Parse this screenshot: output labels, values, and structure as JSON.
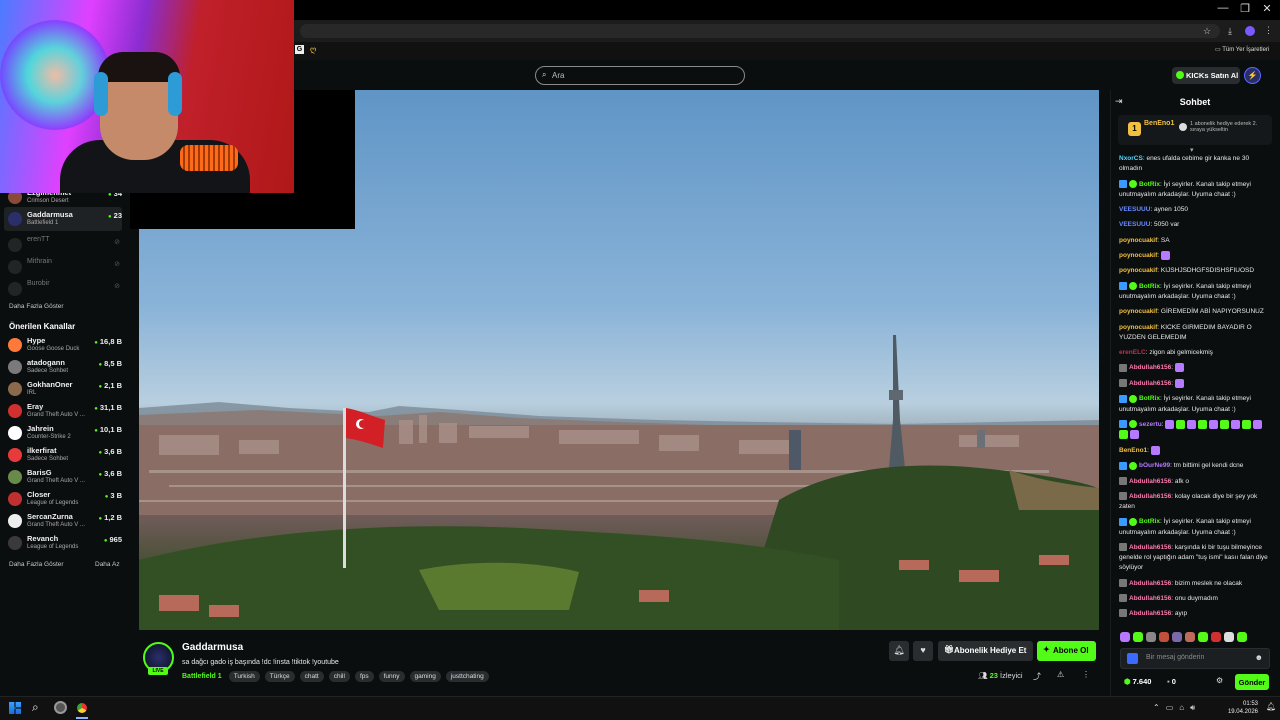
{
  "browser": {
    "bookmarks_label": "Tüm Yer İşaretleri",
    "window_controls": [
      "—",
      "❐",
      "✕"
    ]
  },
  "topnav": {
    "search_placeholder": "Ara",
    "kicks_label": "KICKs Satın Al"
  },
  "sidebar": {
    "followed": [
      {
        "name": "Ezgimehmet",
        "category": "Crimson Desert",
        "viewers": "34",
        "online": true
      },
      {
        "name": "Gaddarmusa",
        "category": "Battlefield 1",
        "viewers": "23",
        "online": true
      },
      {
        "name": "erenTT",
        "online": false
      },
      {
        "name": "Mithrain",
        "online": false
      },
      {
        "name": "Burobir",
        "online": false
      }
    ],
    "show_more": "Daha Fazla Göster",
    "recommended_title": "Önerilen Kanallar",
    "recommended": [
      {
        "name": "Hype",
        "category": "Goose Goose Duck",
        "viewers": "16,8 B",
        "color": "#ff7a3a"
      },
      {
        "name": "atadogann",
        "category": "Sadece Sohbet",
        "viewers": "8,5 B",
        "color": "#7a7a7a"
      },
      {
        "name": "GokhanOner",
        "category": "IRL",
        "viewers": "2,1 B",
        "color": "#8a6a4a"
      },
      {
        "name": "Eray",
        "category": "Grand Theft Auto V ...",
        "viewers": "31,1 B",
        "color": "#d03030"
      },
      {
        "name": "Jahrein",
        "category": "Counter-Strike 2",
        "viewers": "10,1 B",
        "color": "#ffffff"
      },
      {
        "name": "ilkerfirat",
        "category": "Sadece Sohbet",
        "viewers": "3,6 B",
        "color": "#e83a3a"
      },
      {
        "name": "BarisG",
        "category": "Grand Theft Auto V ...",
        "viewers": "3,6 B",
        "color": "#6a8a4a"
      },
      {
        "name": "Closer",
        "category": "League of Legends",
        "viewers": "3 B",
        "color": "#c03030"
      },
      {
        "name": "SercanZurna",
        "category": "Grand Theft Auto V ...",
        "viewers": "1,2 B",
        "color": "#eeeeee"
      },
      {
        "name": "Revanch",
        "category": "League of Legends",
        "viewers": "965",
        "color": "#3a3a3a"
      }
    ],
    "show_more2": "Daha Fazla Göster",
    "show_less": "Daha Az"
  },
  "stream": {
    "channel_name": "Gaddarmusa",
    "live_badge": "LIVE",
    "title": "sa dağcı gado iş başında  !dc !insta !tiktok !youtube",
    "game": "Battlefield 1",
    "tags": [
      "Turkish",
      "Türkçe",
      "chatt",
      "chill",
      "fps",
      "funny",
      "gaming",
      "justtchating"
    ],
    "gift_label": "Abonelik Hediye Et",
    "subscribe_label": "Abone Ol",
    "viewer_count": "23",
    "viewer_suffix": "İzleyici"
  },
  "chat": {
    "title": "Sohbet",
    "pinned": {
      "rank": "1",
      "user": "BenEno1",
      "text": "1 abonelik hediye ederek 2. sıraya yükseltin"
    },
    "messages": [
      {
        "user": "NxorCS",
        "color": "#53d6ff",
        "text": ": enes ufalda cebime gir kanka ne 30 olmadın"
      },
      {
        "user": "BotRix",
        "color": "#53fc18",
        "text": ": İyi seyirler. Kanalı takip etmeyi unutmayalım arkadaşlar. Uyuma chaat :)"
      },
      {
        "user": "VEESUUU",
        "color": "#6a8aff",
        "text": ": aynen 1050"
      },
      {
        "user": "VEESUUU",
        "color": "#6a8aff",
        "text": ": 5050 var"
      },
      {
        "user": "poynocuakif",
        "color": "#f0c040",
        "text": ": SA"
      },
      {
        "user": "poynocuakif",
        "color": "#f0c040",
        "text": ":"
      },
      {
        "user": "poynocuakif",
        "color": "#f0c040",
        "text": ": KIJSHJSDHGFSDISHSFIUOSD"
      },
      {
        "user": "BotRix",
        "color": "#53fc18",
        "text": ": İyi seyirler. Kanalı takip etmeyi unutmayalım arkadaşlar. Uyuma chaat :)"
      },
      {
        "user": "poynocuakif",
        "color": "#f0c040",
        "text": ": GİREMEDİM ABİ NAPIYORSUNUZ"
      },
      {
        "user": "poynocuakif",
        "color": "#f0c040",
        "text": ": KICKE GIRMEDIM BAYADIR O YUZDEN GELEMEDIM"
      },
      {
        "user": "erenELC",
        "color": "#c03050",
        "text": ": zigon abi gelmicekmiş"
      },
      {
        "user": "Abdullah6156",
        "color": "#ff7ab0",
        "text": ":"
      },
      {
        "user": "Abdullah6156",
        "color": "#ff7ab0",
        "text": ":"
      },
      {
        "user": "BotRix",
        "color": "#53fc18",
        "text": ": İyi seyirler. Kanalı takip etmeyi unutmayalım arkadaşlar. Uyuma chaat :)"
      },
      {
        "user": "sezertu",
        "color": "#b57aff",
        "text": ":"
      },
      {
        "user": "BenEno1",
        "color": "#f0c040",
        "text": ":"
      },
      {
        "user": "bOurNe99",
        "color": "#b57aff",
        "text": ": tm bittimi gel kendi dcne"
      },
      {
        "user": "Abdullah6156",
        "color": "#ff7ab0",
        "text": ": afk o"
      },
      {
        "user": "Abdullah6156",
        "color": "#ff7ab0",
        "text": ": kolay olacak diye bir şey yok zaten"
      },
      {
        "user": "BotRix",
        "color": "#53fc18",
        "text": ": İyi seyirler. Kanalı takip etmeyi unutmayalım arkadaşlar. Uyuma chaat :)"
      },
      {
        "user": "Abdullah6156",
        "color": "#ff7ab0",
        "text": ": karşında ki bir tuşu bilmeyince genelde rol yaptığın adam \"tuş ismi\" kasıı falan diye söylüyor"
      },
      {
        "user": "Abdullah6156",
        "color": "#ff7ab0",
        "text": ": bizim meslek ne olacak"
      },
      {
        "user": "Abdullah6156",
        "color": "#ff7ab0",
        "text": ": onu duymadım"
      },
      {
        "user": "Abdullah6156",
        "color": "#ff7ab0",
        "text": ": ayıp"
      }
    ],
    "input_placeholder": "Bir mesaj gönderin",
    "points": "7.640",
    "zero": "0",
    "send_label": "Gönder"
  },
  "taskbar": {
    "time": "01:53",
    "date": "19.04.2026"
  }
}
